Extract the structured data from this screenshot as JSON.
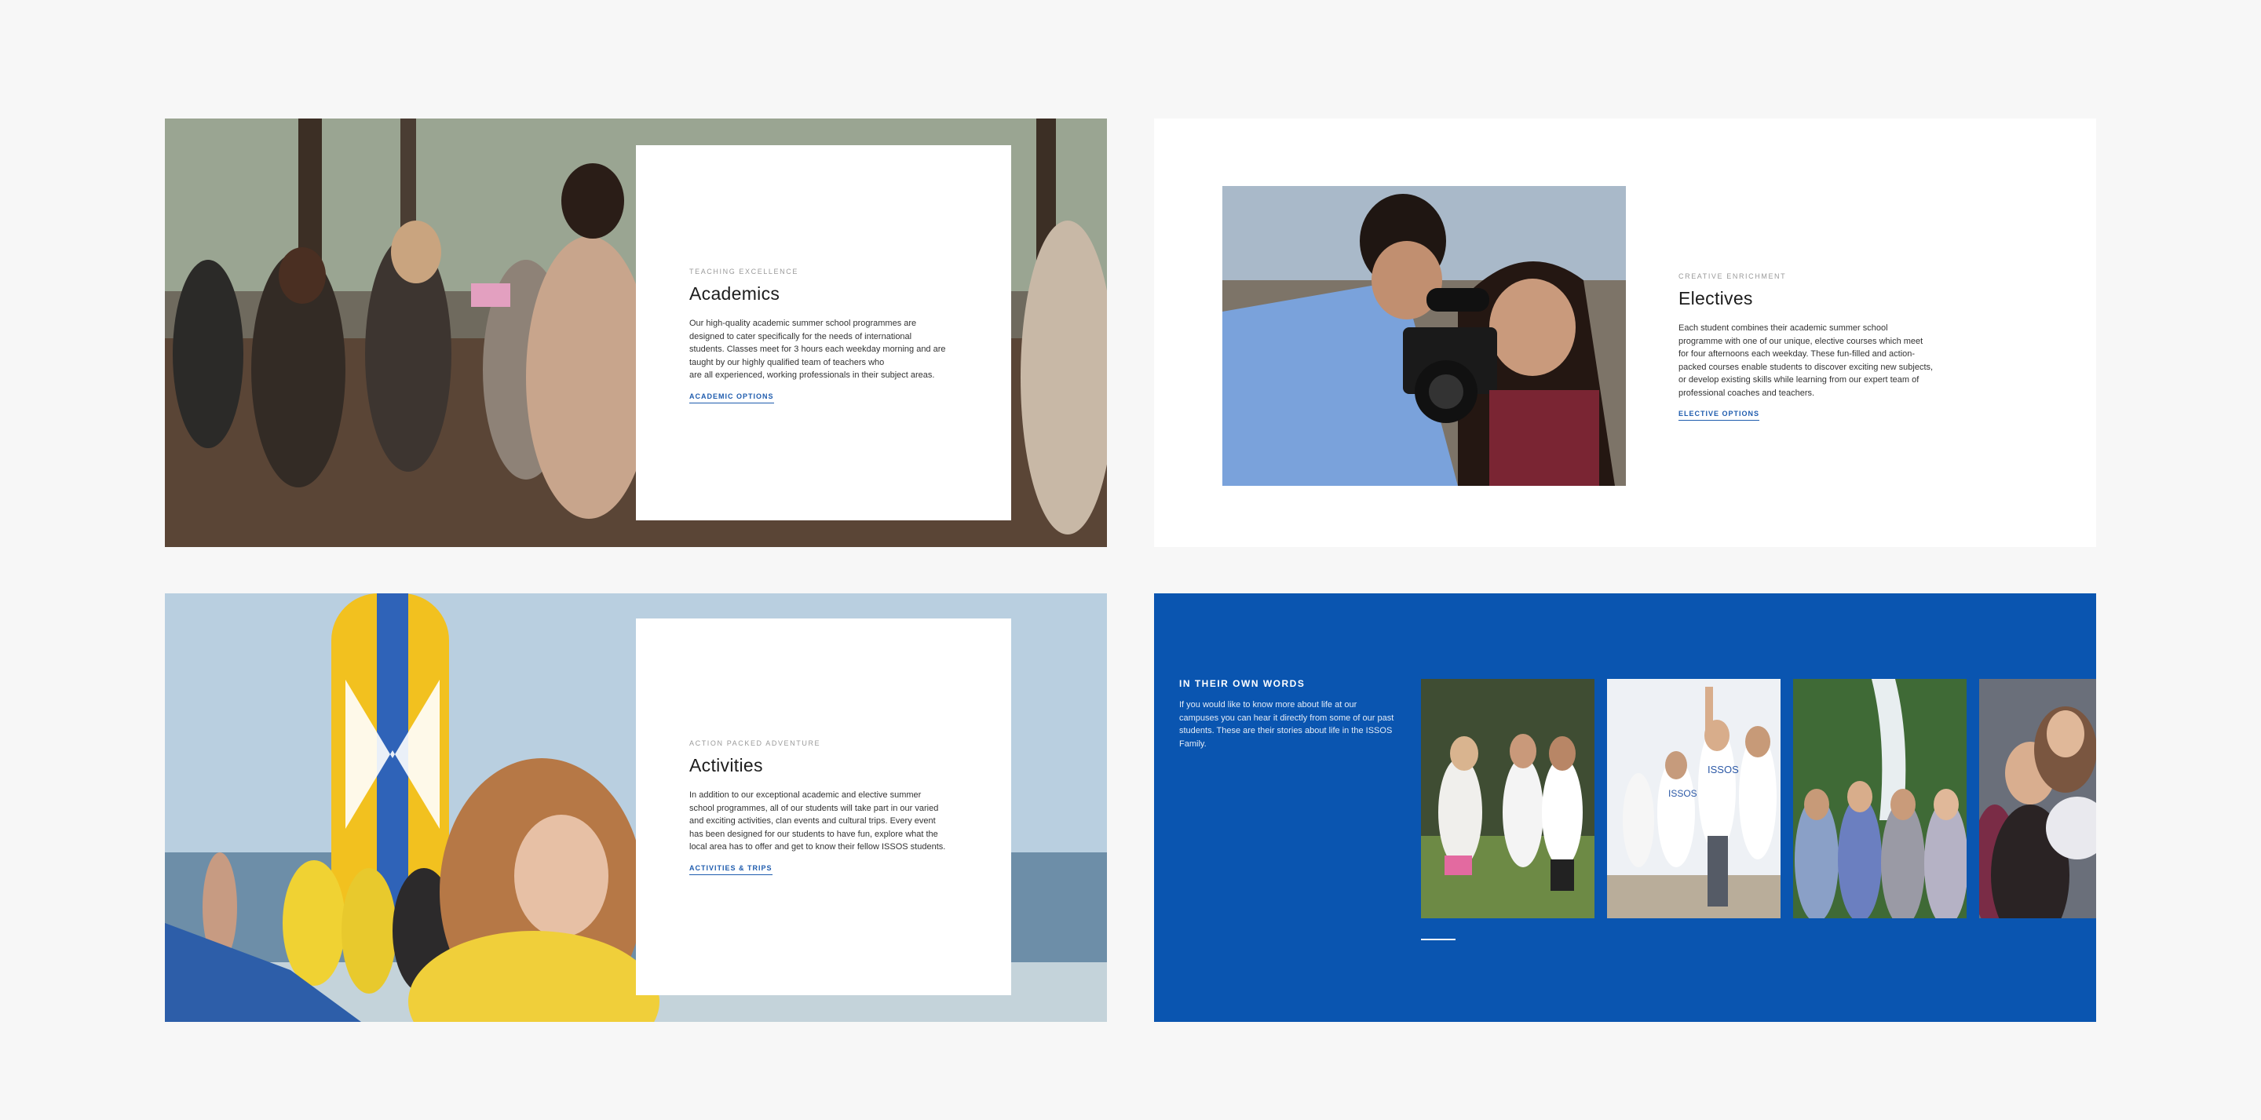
{
  "academics": {
    "eyebrow": "TEACHING EXCELLENCE",
    "title": "Academics",
    "body": "Our high-quality academic summer school programmes are\ndesigned to cater specifically for the needs of international\nstudents. Classes meet for 3 hours each weekday morning and are\ntaught by our highly qualified team of teachers who\nare all experienced, working professionals in their subject areas.",
    "link": "ACADEMIC OPTIONS"
  },
  "electives": {
    "eyebrow": "CREATIVE ENRICHMENT",
    "title": "Electives",
    "body": "Each student combines their academic summer school\nprogramme with one of our unique, elective courses which meet\nfor four afternoons each weekday. These fun-filled and action-\npacked courses enable students to discover exciting new subjects,\nor develop existing skills while learning from our expert team of\nprofessional coaches and teachers.",
    "link": "ELECTIVE OPTIONS"
  },
  "activities": {
    "eyebrow": "ACTION PACKED ADVENTURE",
    "title": "Activities",
    "body": "In addition to our exceptional academic and elective summer\nschool programmes, all of our students will take part in our varied\nand exciting activities, clan events and cultural trips. Every event\nhas been designed for our students to have fun, explore what the\nlocal area has to offer and get to know their fellow ISSOS students.",
    "link": "ACTIVITIES & TRIPS"
  },
  "testimonials": {
    "title": "IN THEIR OWN WORDS",
    "body": "If you would like to know more about life at our\ncampuses you can hear it directly from some of our past\nstudents. These are their stories about life in the ISSOS\nFamily.",
    "slide_count": 4,
    "shirt_text": "ISSOS"
  },
  "colors": {
    "brand_blue": "#0a55b0",
    "link_blue": "#1f5cae",
    "page_bg": "#f7f7f7"
  }
}
